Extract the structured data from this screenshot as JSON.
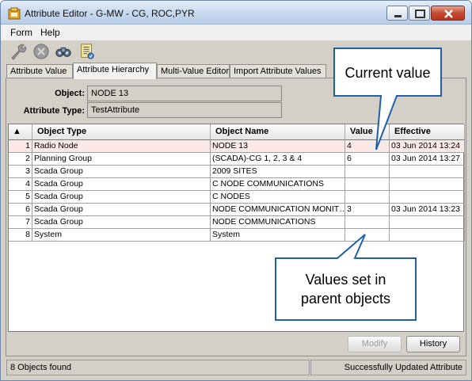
{
  "window": {
    "title": "Attribute Editor - G-MW - CG, ROC,PYR"
  },
  "menu": [
    "Form",
    "Help"
  ],
  "toolbar": {
    "icons": [
      "wrench-icon",
      "stop-icon",
      "binoculars-icon",
      "document-icon"
    ]
  },
  "tabs": [
    {
      "label": "Attribute Value",
      "active": false
    },
    {
      "label": "Attribute Hierarchy",
      "active": true
    },
    {
      "label": "Multi-Value Editor",
      "active": false
    },
    {
      "label": "Import Attribute Values",
      "active": false
    }
  ],
  "form": {
    "object_label": "Object:",
    "object_value": "NODE 13",
    "attr_type_label": "Attribute Type:",
    "attr_type_value": "TestAttribute"
  },
  "table": {
    "sort_indicator": "▲",
    "columns": [
      "Object Type",
      "Object Name",
      "Value",
      "Effective"
    ],
    "rows": [
      {
        "n": "1",
        "type": "Radio Node",
        "name": "NODE 13",
        "value": "4",
        "effective": "03 Jun 2014 13:24",
        "selected": true
      },
      {
        "n": "2",
        "type": "Planning Group",
        "name": "(SCADA)-CG 1, 2, 3 & 4",
        "value": "6",
        "effective": "03 Jun 2014 13:27",
        "selected": false
      },
      {
        "n": "3",
        "type": "Scada Group",
        "name": "2009 SITES",
        "value": "",
        "effective": "",
        "selected": false
      },
      {
        "n": "4",
        "type": "Scada Group",
        "name": "C NODE COMMUNICATIONS",
        "value": "",
        "effective": "",
        "selected": false
      },
      {
        "n": "5",
        "type": "Scada Group",
        "name": "C NODES",
        "value": "",
        "effective": "",
        "selected": false
      },
      {
        "n": "6",
        "type": "Scada Group",
        "name": "NODE COMMUNICATION MONIT…",
        "value": "3",
        "effective": "03 Jun 2014 13:23",
        "selected": false
      },
      {
        "n": "7",
        "type": "Scada Group",
        "name": "NODE COMMUNICATIONS",
        "value": "",
        "effective": "",
        "selected": false
      },
      {
        "n": "8",
        "type": "System",
        "name": "System",
        "value": "",
        "effective": "",
        "selected": false
      }
    ]
  },
  "buttons": {
    "modify": "Modify",
    "history": "History"
  },
  "status": {
    "left": "8 Objects found",
    "right": "Successfully Updated Attribute"
  },
  "callouts": {
    "current_value": "Current value",
    "parent_values_line1": "Values set in",
    "parent_values_line2": "parent objects"
  },
  "colors": {
    "callout_border": "#1f5fa8",
    "selected_row": "#fbe9e8"
  }
}
